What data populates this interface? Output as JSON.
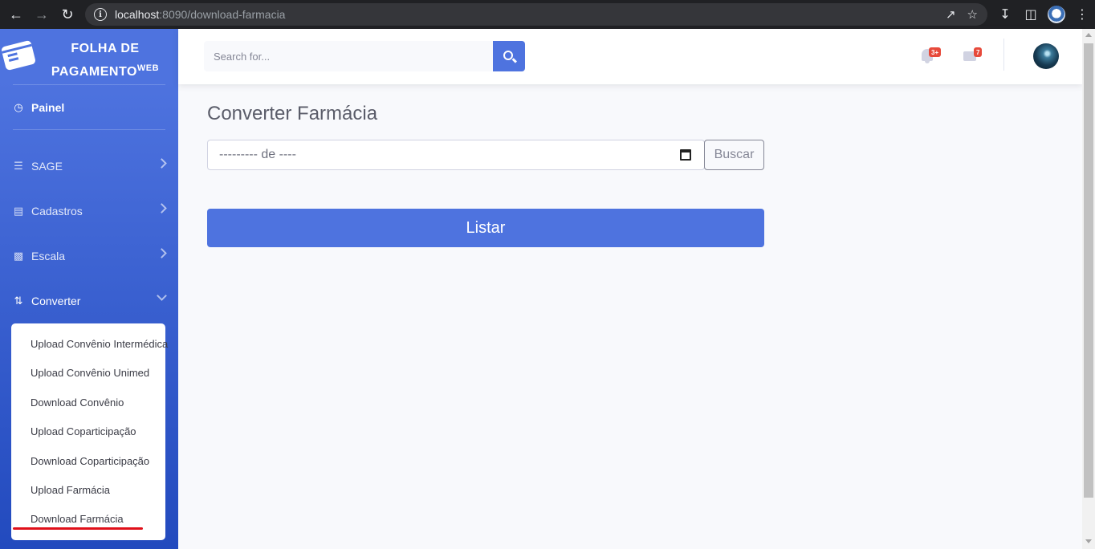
{
  "browser": {
    "url_host": "localhost",
    "url_rest": ":8090/download-farmacia"
  },
  "sidebar": {
    "brand_line1": "FOLHA DE",
    "brand_line2": "PAGAMENTO",
    "brand_sup": "WEB",
    "painel_label": "Painel",
    "items": [
      {
        "label": "SAGE",
        "icon": "database-icon"
      },
      {
        "label": "Cadastros",
        "icon": "file-icon"
      },
      {
        "label": "Escala",
        "icon": "truck-icon"
      },
      {
        "label": "Converter",
        "icon": "retweet-icon"
      }
    ],
    "submenu": [
      "Upload Convênio Intermédica",
      "Upload Convênio Unimed",
      "Download Convênio",
      "Upload Coparticipação",
      "Download Coparticipação",
      "Upload Farmácia",
      "Download Farmácia"
    ]
  },
  "topbar": {
    "search_placeholder": "Search for...",
    "alerts_badge": "3+",
    "messages_badge": "7"
  },
  "main": {
    "title": "Converter Farmácia",
    "month_placeholder": "--------- de ----",
    "buscar_label": "Buscar",
    "listar_label": "Listar"
  },
  "colors": {
    "primary": "#4e73df",
    "sidebar_bottom": "#224abe",
    "badge": "#e74a3b",
    "highlight_underline": "#e0101a"
  }
}
